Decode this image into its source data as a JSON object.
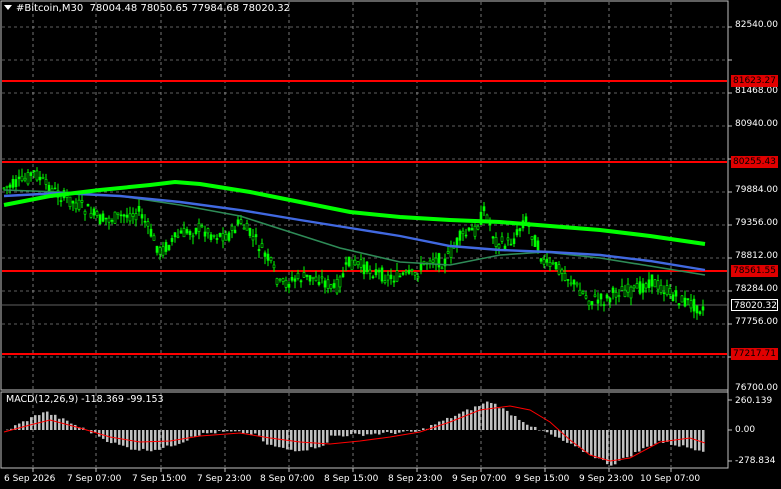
{
  "header": {
    "symbol": "#Bitcoin,M30",
    "ohlc": "78004.48 78050.65 77984.68 78020.32"
  },
  "price_axis": {
    "labels": [
      "82540.00",
      "81468.00",
      "80940.00",
      "79884.00",
      "79356.00",
      "78812.00",
      "78284.00",
      "77756.00",
      "76700.00"
    ],
    "current_price": "78020.32"
  },
  "levels": [
    {
      "label": "81623.27",
      "color": "#ff0000"
    },
    {
      "label": "80255.43",
      "color": "#ff0000"
    },
    {
      "label": "78561.55",
      "color": "#ff0000"
    },
    {
      "label": "77217.71",
      "color": "#ff0000"
    }
  ],
  "macd": {
    "title": "MACD(12,26,9) -118.369 -99.153",
    "labels": [
      "260.139",
      "0.00",
      "-278.834"
    ]
  },
  "time_axis": {
    "labels": [
      "6 Sep 2026",
      "7 Sep 07:00",
      "7 Sep 15:00",
      "7 Sep 23:00",
      "8 Sep 07:00",
      "8 Sep 15:00",
      "8 Sep 23:00",
      "9 Sep 07:00",
      "9 Sep 15:00",
      "9 Sep 23:00",
      "10 Sep 07:00"
    ]
  },
  "colors": {
    "background": "#000000",
    "candles": "#00ff00",
    "ma_fast": "#2e8b57",
    "ma_mid": "#4169e1",
    "ma_slow": "#00ff00",
    "levels": "#ff0000",
    "macd_hist": "#c0c0c0",
    "macd_signal": "#ff0000",
    "grid": "#c0c0c0"
  }
}
